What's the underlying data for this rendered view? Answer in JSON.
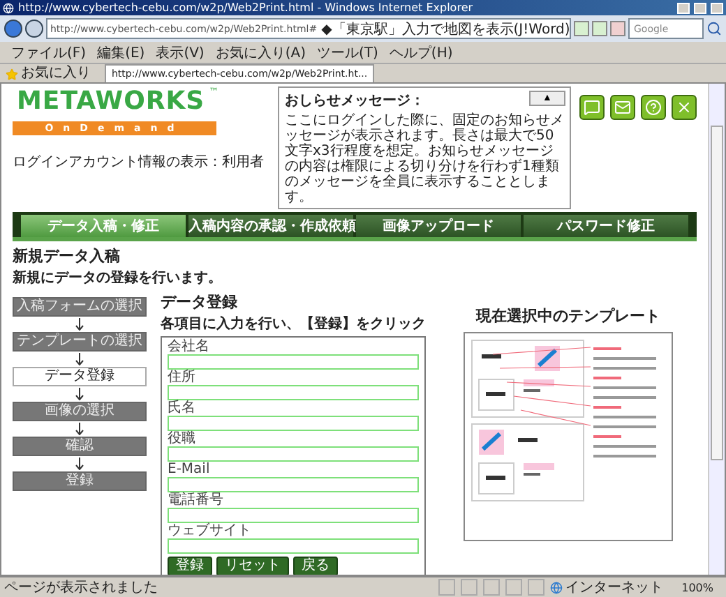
{
  "browser": {
    "title": "http://www.cybertech-cebu.com/w2p/Web2Print.html - Windows Internet Explorer",
    "url": "http://www.cybertech-cebu.com/w2p/Web2Print.html#",
    "address_hint": "◆「東京駅」入力で地図を表示(J!Word)",
    "search_placeholder": "Google",
    "menus": [
      "ファイル(F)",
      "編集(E)",
      "表示(V)",
      "お気に入り(A)",
      "ツール(T)",
      "ヘルプ(H)"
    ],
    "favorites": "お気に入り",
    "tab_title": "http://www.cybertech-cebu.com/w2p/Web2Print.ht..."
  },
  "header": {
    "logo": {
      "name": "METAWORKS",
      "trademark": "™",
      "tagline": "OnDemand"
    },
    "account": "ログインアカウント情報の表示：利用者",
    "notice": {
      "title": "おしらせメッセージ：",
      "toggle": "▲",
      "body": "ここにログインした際に、固定のお知らせメッセージが表示されます。長さは最大で50文字x3行程度を想定。お知らせメッセージの内容は権限による切り分けを行わず1種類のメッセージを全員に表示することとします。"
    }
  },
  "nav_tabs": [
    {
      "label": "データ入稿・修正",
      "selected": true
    },
    {
      "label": "入稿内容の承認・作成依頼",
      "selected": false
    },
    {
      "label": "画像アップロード",
      "selected": false
    },
    {
      "label": "パスワード修正",
      "selected": false
    }
  ],
  "page": {
    "title": "新規データ入稿",
    "description": "新規にデータの登録を行います。"
  },
  "steps": [
    {
      "label": "入稿フォームの選択",
      "selected": false
    },
    {
      "label": "テンプレートの選択",
      "selected": false
    },
    {
      "label": "データ登録",
      "selected": true
    },
    {
      "label": "画像の選択",
      "selected": false
    },
    {
      "label": "確認",
      "selected": false
    },
    {
      "label": "登録",
      "selected": false
    }
  ],
  "form": {
    "title": "データ登録",
    "instruction": "各項目に入力を行い、【登録】をクリック",
    "fields": [
      {
        "label": "会社名"
      },
      {
        "label": "住所"
      },
      {
        "label": "氏名"
      },
      {
        "label": "役職"
      },
      {
        "label": "E-Mail"
      },
      {
        "label": "電話番号"
      },
      {
        "label": "ウェブサイト"
      }
    ],
    "buttons": [
      "登録",
      "リセット",
      "戻る"
    ]
  },
  "template": {
    "title": "現在選択中のテンプレート"
  },
  "status_bar": {
    "text": "ページが表示されました",
    "zone": "インターネット",
    "zoom": "100%"
  }
}
